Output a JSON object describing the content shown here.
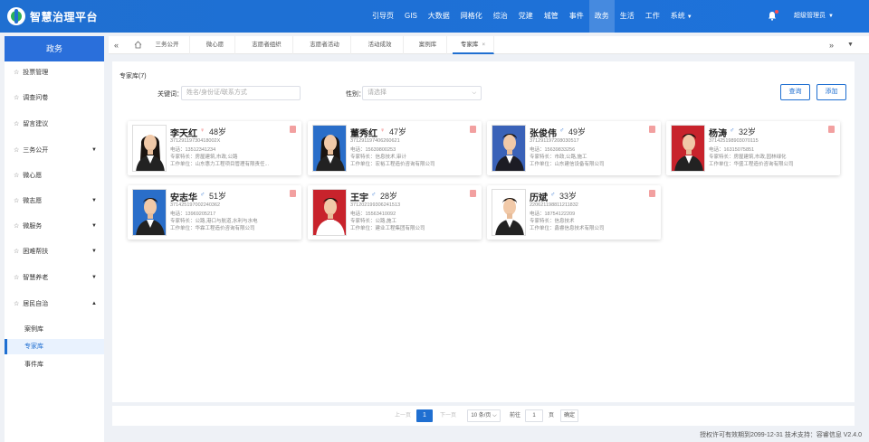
{
  "app": {
    "title": "智慧治理平台"
  },
  "nav": [
    {
      "label": "引导页"
    },
    {
      "label": "GIS"
    },
    {
      "label": "大数据"
    },
    {
      "label": "网格化"
    },
    {
      "label": "综治"
    },
    {
      "label": "党建"
    },
    {
      "label": "城管"
    },
    {
      "label": "事件"
    },
    {
      "label": "政务",
      "active": true
    },
    {
      "label": "生活"
    },
    {
      "label": "工作"
    },
    {
      "label": "系统",
      "caret": true
    }
  ],
  "user": {
    "name": "超级管理员"
  },
  "sidebar": {
    "title": "政务",
    "items": [
      {
        "label": "投票管理",
        "expand": ""
      },
      {
        "label": "调查问卷",
        "expand": ""
      },
      {
        "label": "留言建议",
        "expand": ""
      },
      {
        "label": "三务公开",
        "expand": "▼"
      },
      {
        "label": "微心愿",
        "expand": ""
      },
      {
        "label": "微志愿",
        "expand": "▼"
      },
      {
        "label": "微服务",
        "expand": "▼"
      },
      {
        "label": "困难帮扶",
        "expand": "▼"
      },
      {
        "label": "智慧养老",
        "expand": "▼"
      },
      {
        "label": "居民自治",
        "expand": "▲"
      }
    ],
    "subitems": [
      {
        "label": "案例库"
      },
      {
        "label": "专家库",
        "active": true
      },
      {
        "label": "事件库"
      }
    ]
  },
  "tabs": [
    {
      "label": "三务公开"
    },
    {
      "label": "微心愿"
    },
    {
      "label": "志愿者组织"
    },
    {
      "label": "志愿者活动"
    },
    {
      "label": "活动成效"
    },
    {
      "label": "案例库"
    },
    {
      "label": "专家库",
      "active": true
    }
  ],
  "main": {
    "title": "专家库(7)",
    "keyword_label": "关键词：",
    "keyword_placeholder": "姓名/身份证/联系方式",
    "category_label": "性别：",
    "category_placeholder": "请选择",
    "search_btn": "查询",
    "add_btn": "添加"
  },
  "experts": [
    {
      "name": "李天红",
      "gender": "f",
      "age": "48岁",
      "id": "371291197304180​02X",
      "phone": "电话：13512341234",
      "spec": "专家特长：房屋建筑,市政,公路",
      "org": "工作单位：山东惠力工程项目管理有限责任..."
    },
    {
      "name": "董秀红",
      "gender": "f",
      "age": "47岁",
      "id": "371291197406260621",
      "phone": "电话：15639800253",
      "spec": "专家特长：信息技术,审计",
      "org": "工作单位：宏裕工程造价咨询有限公司"
    },
    {
      "name": "张俊伟",
      "gender": "m",
      "age": "49岁",
      "id": "371291197208030517",
      "phone": "电话：15639833256",
      "spec": "专家特长：市政,公路,施工",
      "org": "工作单位：山东建信设备有限公司"
    },
    {
      "name": "杨涛",
      "gender": "m",
      "age": "32岁",
      "id": "371425198903070115",
      "phone": "电话：16315075851",
      "spec": "专家特长：房屋建筑,市政,园林绿化",
      "org": "工作单位：华盛工程造价咨询有限公司"
    },
    {
      "name": "安志华",
      "gender": "m",
      "age": "51岁",
      "id": "371425197002240362",
      "phone": "电话：13969205217",
      "spec": "专家特长：公路,港口与航道,水利与水电",
      "org": "工作单位：华霖工程造价咨询有限公司"
    },
    {
      "name": "王宇",
      "gender": "m",
      "age": "28岁",
      "id": "371202199306241513",
      "phone": "电话：15563410092",
      "spec": "专家特长：公路,施工",
      "org": "工作单位：建业工程集团有限公司"
    },
    {
      "name": "历斌",
      "gender": "m",
      "age": "33岁",
      "id": "220621198811211832",
      "phone": "电话：18754122209",
      "spec": "专家特长：信息技术",
      "org": "工作单位：鑫睿信息技术有限公司"
    }
  ],
  "pager": {
    "prev": "上一页",
    "page": "1",
    "next": "下一页",
    "size": "10 条/页",
    "goto": "前往",
    "goto_value": "1",
    "unit": "页",
    "confirm": "确定"
  },
  "footer": "授权许可有效期到2099-12-31 技术支持：容睿信息 V2.4.0"
}
